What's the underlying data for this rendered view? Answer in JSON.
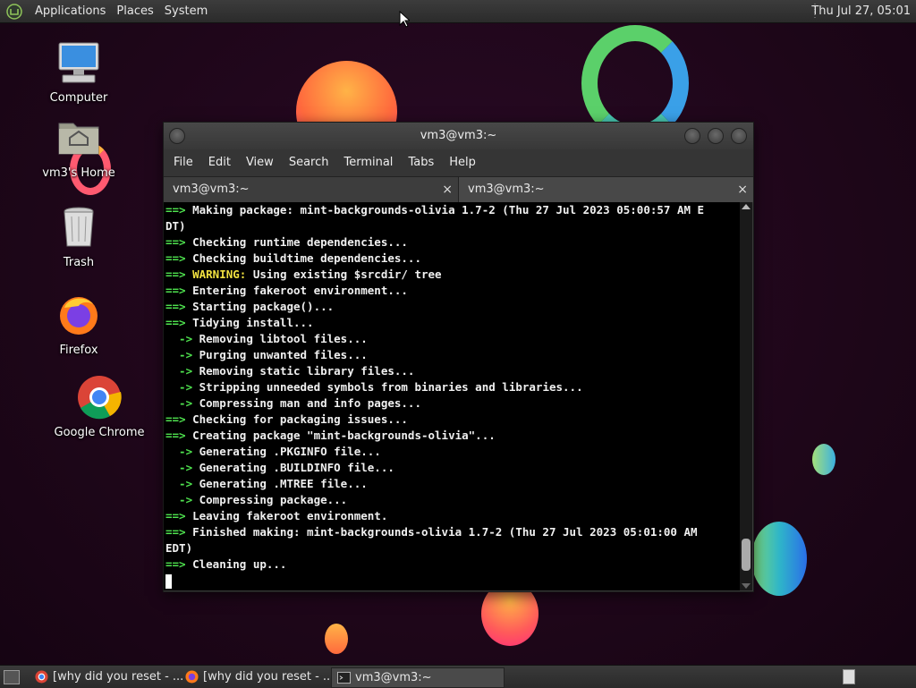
{
  "top_panel": {
    "menus": [
      "Applications",
      "Places",
      "System"
    ],
    "clock": "Thu Jul 27, 05:01"
  },
  "desktop_icons": [
    {
      "label": "Computer",
      "icon": "computer-icon"
    },
    {
      "label": "vm3's Home",
      "icon": "home-folder-icon"
    },
    {
      "label": "Trash",
      "icon": "trash-icon"
    },
    {
      "label": "Firefox",
      "icon": "firefox-icon"
    },
    {
      "label": "Google Chrome",
      "icon": "chrome-icon"
    }
  ],
  "terminal": {
    "title": "vm3@vm3:~",
    "menu": [
      "File",
      "Edit",
      "View",
      "Search",
      "Terminal",
      "Tabs",
      "Help"
    ],
    "tabs": [
      {
        "label": "vm3@vm3:~",
        "close": "×"
      },
      {
        "label": "vm3@vm3:~",
        "close": "×"
      }
    ],
    "lines": [
      {
        "prefix": "==>",
        "text": " Making package: mint-backgrounds-olivia 1.7-2 (Thu 27 Jul 2023 05:00:57 AM E"
      },
      {
        "prefix": "",
        "text": "DT)"
      },
      {
        "prefix": "==>",
        "text": " Checking runtime dependencies..."
      },
      {
        "prefix": "==>",
        "text": " Checking buildtime dependencies..."
      },
      {
        "prefix": "==>",
        "warn": " WARNING:",
        "text": " Using existing $srcdir/ tree"
      },
      {
        "prefix": "==>",
        "text": " Entering fakeroot environment..."
      },
      {
        "prefix": "==>",
        "text": " Starting package()..."
      },
      {
        "prefix": "==>",
        "text": " Tidying install..."
      },
      {
        "prefix": "  ->",
        "text": " Removing libtool files..."
      },
      {
        "prefix": "  ->",
        "text": " Purging unwanted files..."
      },
      {
        "prefix": "  ->",
        "text": " Removing static library files..."
      },
      {
        "prefix": "  ->",
        "text": " Stripping unneeded symbols from binaries and libraries..."
      },
      {
        "prefix": "  ->",
        "text": " Compressing man and info pages..."
      },
      {
        "prefix": "==>",
        "text": " Checking for packaging issues..."
      },
      {
        "prefix": "==>",
        "text": " Creating package \"mint-backgrounds-olivia\"..."
      },
      {
        "prefix": "  ->",
        "text": " Generating .PKGINFO file..."
      },
      {
        "prefix": "  ->",
        "text": " Generating .BUILDINFO file..."
      },
      {
        "prefix": "  ->",
        "text": " Generating .MTREE file..."
      },
      {
        "prefix": "  ->",
        "text": " Compressing package..."
      },
      {
        "prefix": "==>",
        "text": " Leaving fakeroot environment."
      },
      {
        "prefix": "==>",
        "text": " Finished making: mint-backgrounds-olivia 1.7-2 (Thu 27 Jul 2023 05:01:00 AM"
      },
      {
        "prefix": "",
        "text": "EDT)"
      },
      {
        "prefix": "==>",
        "text": " Cleaning up..."
      }
    ]
  },
  "taskbar": {
    "items": [
      {
        "label": "[why did you reset - ...",
        "icon": "chrome-icon"
      },
      {
        "label": "[why did you reset - ...",
        "icon": "firefox-icon"
      },
      {
        "label": "vm3@vm3:~",
        "icon": "terminal-icon"
      }
    ]
  },
  "colors": {
    "prompt_green": "#4fe34f",
    "warning_yellow": "#f0e040",
    "terminal_bg": "#000000"
  }
}
